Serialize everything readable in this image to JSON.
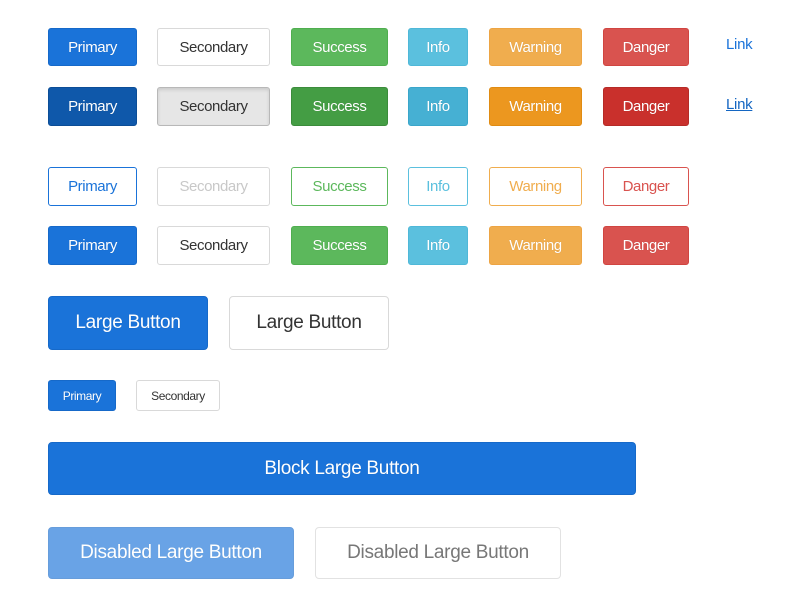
{
  "rows": {
    "default": [
      {
        "variant": "primary",
        "label": "Primary"
      },
      {
        "variant": "secondary",
        "label": "Secondary"
      },
      {
        "variant": "success",
        "label": "Success"
      },
      {
        "variant": "info",
        "label": "Info"
      },
      {
        "variant": "warning",
        "label": "Warning"
      },
      {
        "variant": "danger",
        "label": "Danger"
      },
      {
        "variant": "link",
        "label": "Link"
      }
    ],
    "active": [
      {
        "variant": "primary",
        "label": "Primary",
        "state": "active"
      },
      {
        "variant": "secondary",
        "label": "Secondary",
        "state": "active"
      },
      {
        "variant": "success",
        "label": "Success",
        "state": "active"
      },
      {
        "variant": "info",
        "label": "Info",
        "state": "active"
      },
      {
        "variant": "warning",
        "label": "Warning",
        "state": "active"
      },
      {
        "variant": "danger",
        "label": "Danger",
        "state": "active"
      },
      {
        "variant": "link",
        "label": "Link",
        "state": "active"
      }
    ],
    "outline": [
      {
        "variant": "primary",
        "label": "Primary",
        "style": "outline"
      },
      {
        "variant": "secondary",
        "label": "Secondary",
        "style": "outline"
      },
      {
        "variant": "success",
        "label": "Success",
        "style": "outline"
      },
      {
        "variant": "info",
        "label": "Info",
        "style": "outline"
      },
      {
        "variant": "warning",
        "label": "Warning",
        "style": "outline"
      },
      {
        "variant": "danger",
        "label": "Danger",
        "style": "outline"
      }
    ],
    "solid": [
      {
        "variant": "primary",
        "label": "Primary"
      },
      {
        "variant": "secondary",
        "label": "Secondary"
      },
      {
        "variant": "success",
        "label": "Success"
      },
      {
        "variant": "info",
        "label": "Info"
      },
      {
        "variant": "warning",
        "label": "Warning"
      },
      {
        "variant": "danger",
        "label": "Danger"
      }
    ]
  },
  "large": {
    "primary_label": "Large Button",
    "secondary_label": "Large Button"
  },
  "small": {
    "primary_label": "Primary",
    "secondary_label": "Secondary"
  },
  "block": {
    "label": "Block Large Button"
  },
  "disabled": {
    "primary_label": "Disabled Large Button",
    "secondary_label": "Disabled Large Button"
  },
  "colors": {
    "primary": "#1a73d9",
    "secondary_border": "#d9d9d9",
    "success": "#5cb85c",
    "info": "#5bc0de",
    "warning": "#f0ad4e",
    "danger": "#d9534f"
  }
}
